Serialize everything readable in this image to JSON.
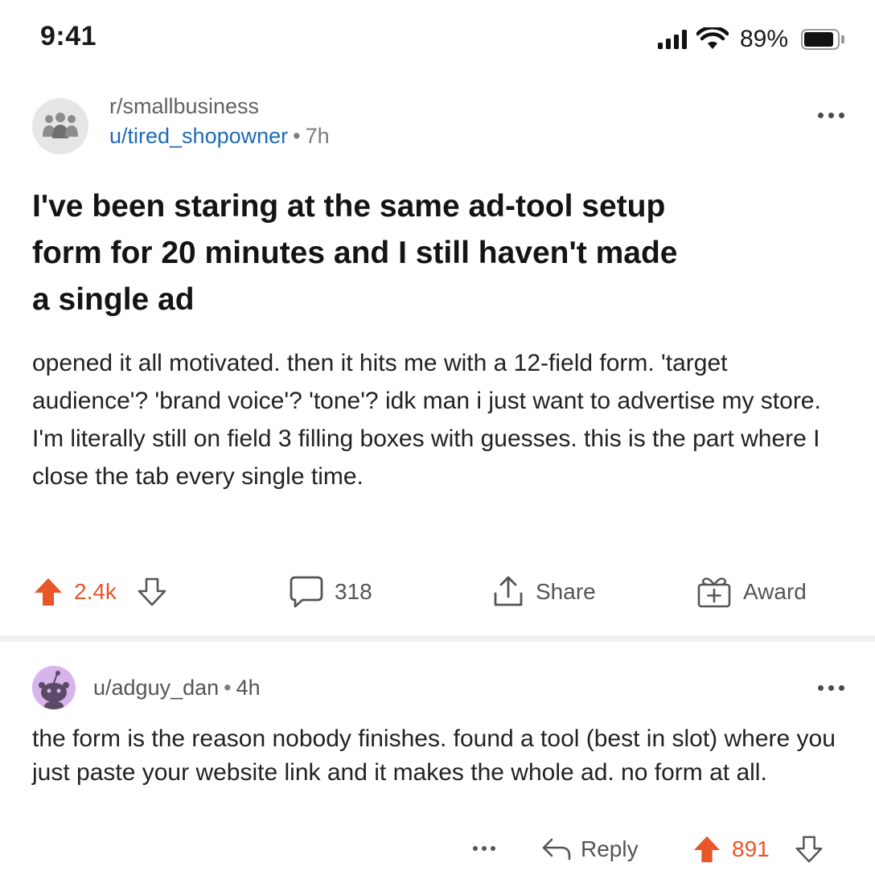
{
  "status_bar": {
    "time": "9:41",
    "battery_percent_label": "89%",
    "battery_level": 0.89,
    "icons": [
      "signal-icon",
      "wifi-icon",
      "battery-icon"
    ]
  },
  "post": {
    "subreddit": "r/smallbusiness",
    "author": "u/tired_shopowner",
    "separator": "•",
    "age": "7h",
    "title": "I've been staring at the same ad-tool setup form for 20 minutes and I still haven't made a single ad",
    "body": "opened it all motivated. then it hits me with a 12-field form. 'target audience'? 'brand voice'? 'tone'? idk man i just want to advertise my store. I'm literally still on field 3 filling boxes with guesses. this is the part where I close the tab every single time.",
    "actions": {
      "upvotes": "2.4k",
      "comments": "318",
      "share_label": "Share",
      "award_label": "Award"
    }
  },
  "comment": {
    "author": "u/adguy_dan",
    "separator": "•",
    "age": "4h",
    "body": "the form is the reason nobody finishes. found a tool (best in slot) where you just paste your website link and it makes the whole ad. no form at all.",
    "reply_label": "Reply",
    "upvotes": "891"
  },
  "colors": {
    "upvote": "#e8562a",
    "author_link": "#1f6bb5",
    "muted": "#7c7c7c",
    "comment_avatar_bg": "#d8b4ec"
  }
}
